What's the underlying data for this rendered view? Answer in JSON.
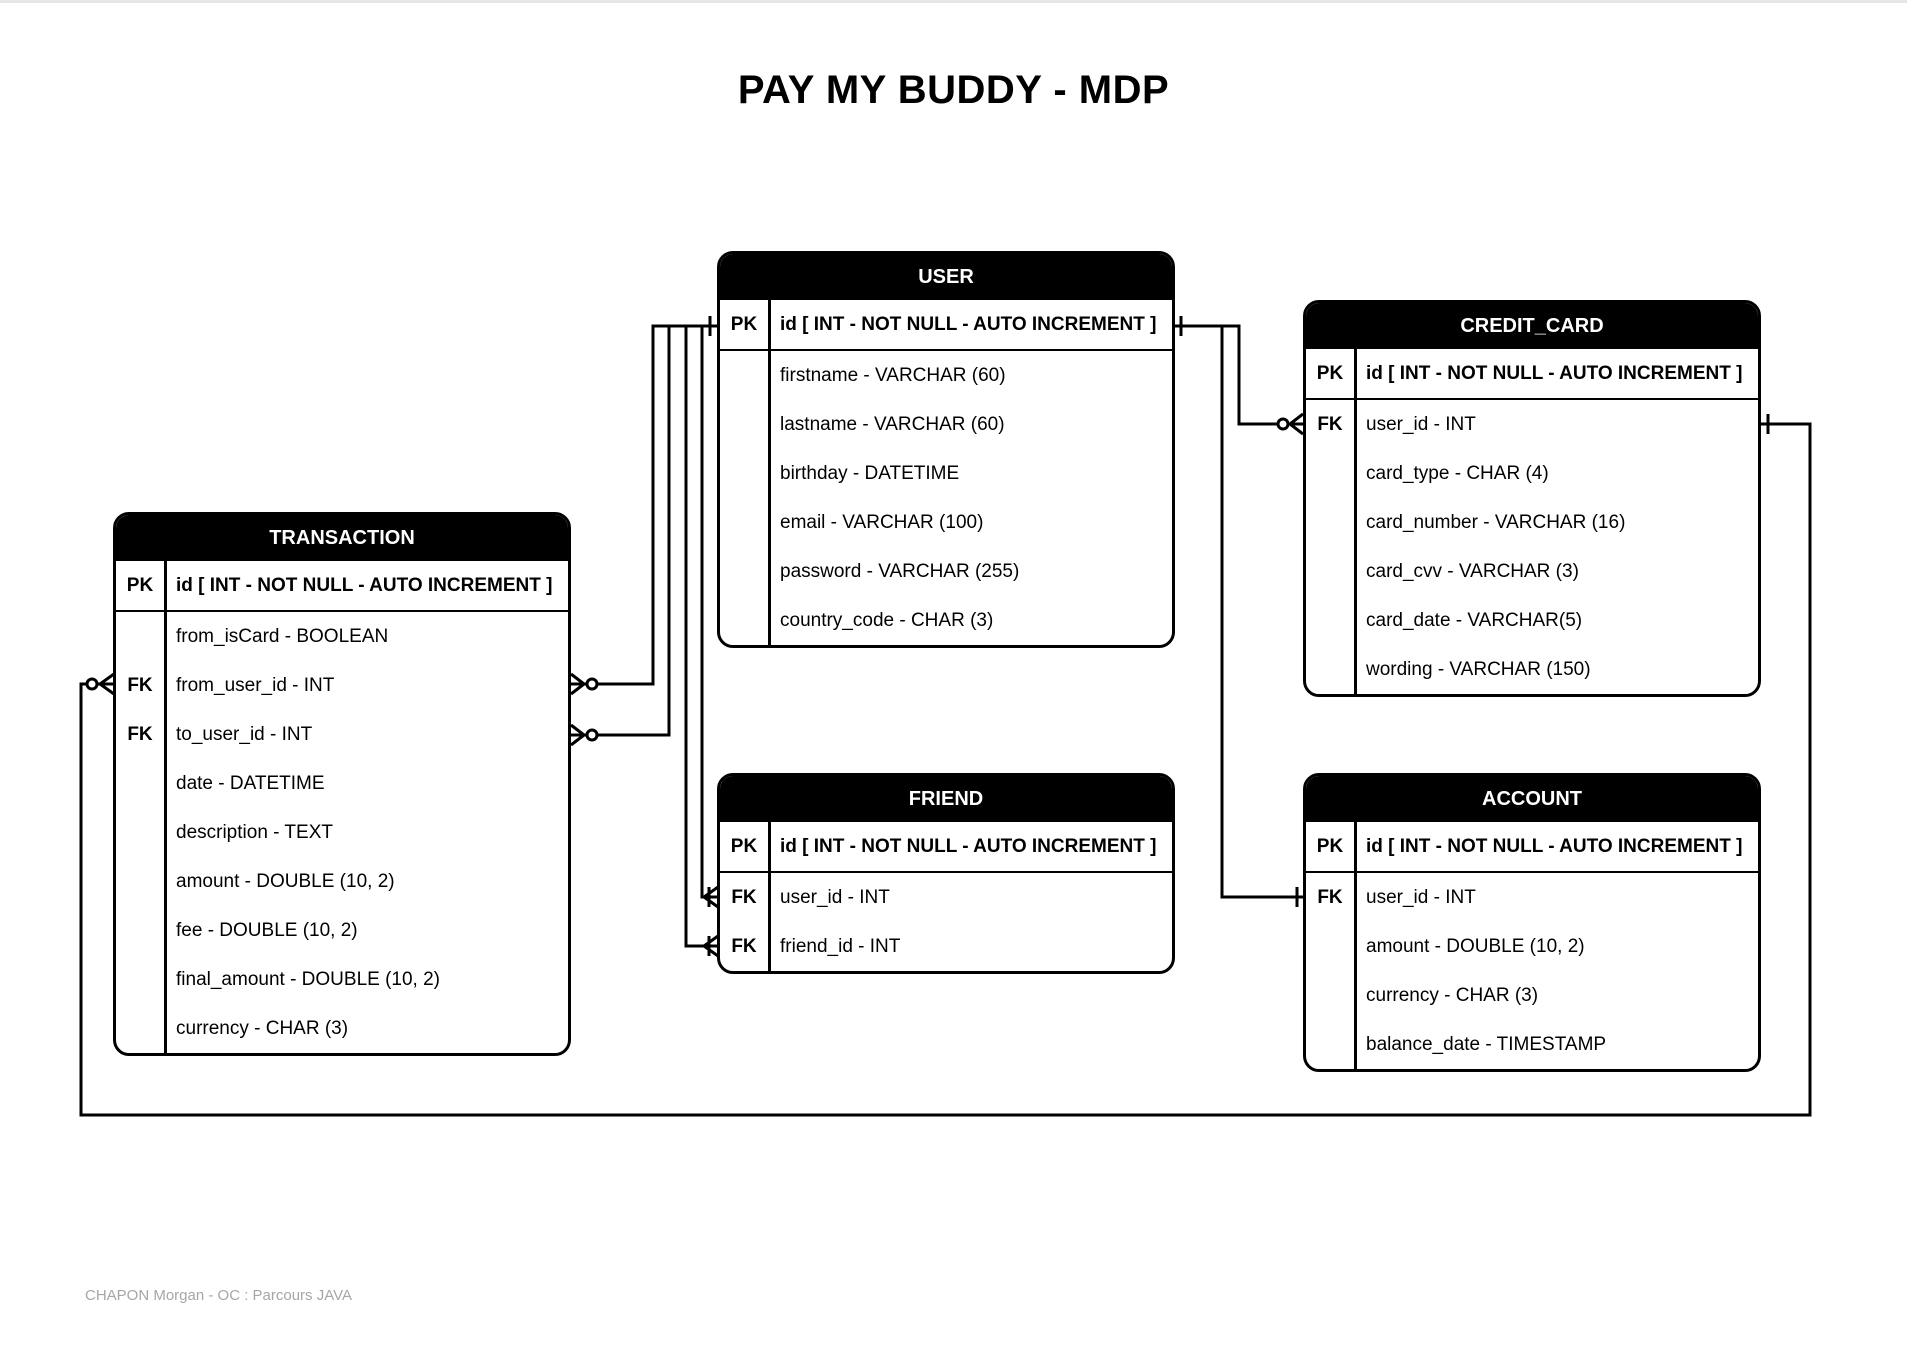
{
  "diagram": {
    "title": "PAY MY BUDDY - MDP",
    "footer": "CHAPON Morgan - OC : Parcours JAVA",
    "entities": {
      "user": {
        "name": "USER",
        "rows": [
          {
            "key": "PK",
            "field": "id [ INT - NOT NULL - AUTO INCREMENT ]"
          },
          {
            "key": "",
            "field": "firstname - VARCHAR (60)"
          },
          {
            "key": "",
            "field": "lastname - VARCHAR (60)"
          },
          {
            "key": "",
            "field": "birthday - DATETIME"
          },
          {
            "key": "",
            "field": "email - VARCHAR (100)"
          },
          {
            "key": "",
            "field": "password - VARCHAR (255)"
          },
          {
            "key": "",
            "field": "country_code - CHAR (3)"
          }
        ]
      },
      "credit_card": {
        "name": "CREDIT_CARD",
        "rows": [
          {
            "key": "PK",
            "field": "id [ INT - NOT NULL - AUTO INCREMENT ]"
          },
          {
            "key": "FK",
            "field": "user_id - INT"
          },
          {
            "key": "",
            "field": "card_type - CHAR (4)"
          },
          {
            "key": "",
            "field": "card_number - VARCHAR (16)"
          },
          {
            "key": "",
            "field": "card_cvv - VARCHAR (3)"
          },
          {
            "key": "",
            "field": "card_date - VARCHAR(5)"
          },
          {
            "key": "",
            "field": "wording - VARCHAR (150)"
          }
        ]
      },
      "transaction": {
        "name": "TRANSACTION",
        "rows": [
          {
            "key": "PK",
            "field": "id [ INT - NOT NULL - AUTO INCREMENT ]"
          },
          {
            "key": "",
            "field": "from_isCard - BOOLEAN"
          },
          {
            "key": "FK",
            "field": "from_user_id - INT"
          },
          {
            "key": "FK",
            "field": "to_user_id - INT"
          },
          {
            "key": "",
            "field": "date - DATETIME"
          },
          {
            "key": "",
            "field": "description - TEXT"
          },
          {
            "key": "",
            "field": "amount - DOUBLE (10, 2)"
          },
          {
            "key": "",
            "field": "fee - DOUBLE (10, 2)"
          },
          {
            "key": "",
            "field": "final_amount - DOUBLE (10, 2)"
          },
          {
            "key": "",
            "field": "currency - CHAR (3)"
          }
        ]
      },
      "friend": {
        "name": "FRIEND",
        "rows": [
          {
            "key": "PK",
            "field": "id [ INT - NOT NULL - AUTO INCREMENT ]"
          },
          {
            "key": "FK",
            "field": "user_id - INT"
          },
          {
            "key": "FK",
            "field": "friend_id - INT"
          }
        ]
      },
      "account": {
        "name": "ACCOUNT",
        "rows": [
          {
            "key": "PK",
            "field": "id [ INT - NOT NULL - AUTO INCREMENT ]"
          },
          {
            "key": "FK",
            "field": "user_id - INT"
          },
          {
            "key": "",
            "field": "amount - DOUBLE (10, 2)"
          },
          {
            "key": "",
            "field": "currency - CHAR (3)"
          },
          {
            "key": "",
            "field": "balance_date - TIMESTAMP"
          }
        ]
      }
    },
    "relationships": [
      {
        "from": "user.id",
        "to": "credit_card.user_id",
        "cardinality": "one-to-zero-or-many"
      },
      {
        "from": "user.id",
        "to": "account.user_id",
        "cardinality": "one-to-one"
      },
      {
        "from": "user.id",
        "to": "transaction.from_user_id",
        "cardinality": "one-to-zero-or-many"
      },
      {
        "from": "user.id",
        "to": "transaction.to_user_id",
        "cardinality": "one-to-zero-or-many"
      },
      {
        "from": "user.id",
        "to": "friend.user_id",
        "cardinality": "one-to-one-or-many"
      },
      {
        "from": "user.id",
        "to": "friend.friend_id",
        "cardinality": "one-to-one-or-many"
      },
      {
        "from": "credit_card.user_id",
        "to": "transaction.from_user_id",
        "cardinality": "one-to-zero-or-many"
      }
    ]
  }
}
